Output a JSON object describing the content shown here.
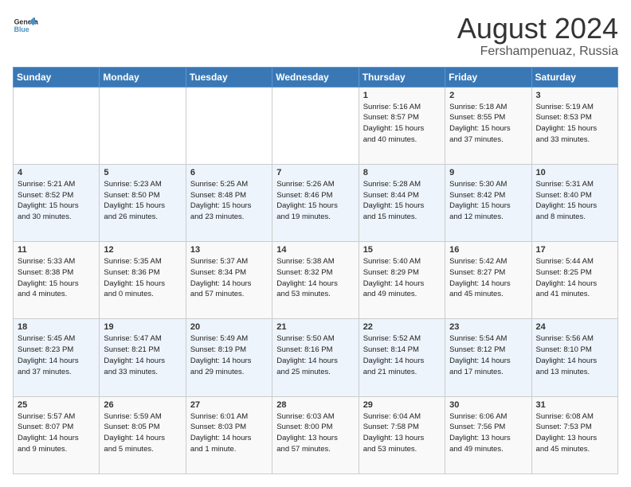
{
  "logo": {
    "line1": "General",
    "line2": "Blue"
  },
  "title": "August 2024",
  "subtitle": "Fershampenuaz, Russia",
  "days_of_week": [
    "Sunday",
    "Monday",
    "Tuesday",
    "Wednesday",
    "Thursday",
    "Friday",
    "Saturday"
  ],
  "weeks": [
    [
      {
        "day": "",
        "info": ""
      },
      {
        "day": "",
        "info": ""
      },
      {
        "day": "",
        "info": ""
      },
      {
        "day": "",
        "info": ""
      },
      {
        "day": "1",
        "info": "Sunrise: 5:16 AM\nSunset: 8:57 PM\nDaylight: 15 hours\nand 40 minutes."
      },
      {
        "day": "2",
        "info": "Sunrise: 5:18 AM\nSunset: 8:55 PM\nDaylight: 15 hours\nand 37 minutes."
      },
      {
        "day": "3",
        "info": "Sunrise: 5:19 AM\nSunset: 8:53 PM\nDaylight: 15 hours\nand 33 minutes."
      }
    ],
    [
      {
        "day": "4",
        "info": "Sunrise: 5:21 AM\nSunset: 8:52 PM\nDaylight: 15 hours\nand 30 minutes."
      },
      {
        "day": "5",
        "info": "Sunrise: 5:23 AM\nSunset: 8:50 PM\nDaylight: 15 hours\nand 26 minutes."
      },
      {
        "day": "6",
        "info": "Sunrise: 5:25 AM\nSunset: 8:48 PM\nDaylight: 15 hours\nand 23 minutes."
      },
      {
        "day": "7",
        "info": "Sunrise: 5:26 AM\nSunset: 8:46 PM\nDaylight: 15 hours\nand 19 minutes."
      },
      {
        "day": "8",
        "info": "Sunrise: 5:28 AM\nSunset: 8:44 PM\nDaylight: 15 hours\nand 15 minutes."
      },
      {
        "day": "9",
        "info": "Sunrise: 5:30 AM\nSunset: 8:42 PM\nDaylight: 15 hours\nand 12 minutes."
      },
      {
        "day": "10",
        "info": "Sunrise: 5:31 AM\nSunset: 8:40 PM\nDaylight: 15 hours\nand 8 minutes."
      }
    ],
    [
      {
        "day": "11",
        "info": "Sunrise: 5:33 AM\nSunset: 8:38 PM\nDaylight: 15 hours\nand 4 minutes."
      },
      {
        "day": "12",
        "info": "Sunrise: 5:35 AM\nSunset: 8:36 PM\nDaylight: 15 hours\nand 0 minutes."
      },
      {
        "day": "13",
        "info": "Sunrise: 5:37 AM\nSunset: 8:34 PM\nDaylight: 14 hours\nand 57 minutes."
      },
      {
        "day": "14",
        "info": "Sunrise: 5:38 AM\nSunset: 8:32 PM\nDaylight: 14 hours\nand 53 minutes."
      },
      {
        "day": "15",
        "info": "Sunrise: 5:40 AM\nSunset: 8:29 PM\nDaylight: 14 hours\nand 49 minutes."
      },
      {
        "day": "16",
        "info": "Sunrise: 5:42 AM\nSunset: 8:27 PM\nDaylight: 14 hours\nand 45 minutes."
      },
      {
        "day": "17",
        "info": "Sunrise: 5:44 AM\nSunset: 8:25 PM\nDaylight: 14 hours\nand 41 minutes."
      }
    ],
    [
      {
        "day": "18",
        "info": "Sunrise: 5:45 AM\nSunset: 8:23 PM\nDaylight: 14 hours\nand 37 minutes."
      },
      {
        "day": "19",
        "info": "Sunrise: 5:47 AM\nSunset: 8:21 PM\nDaylight: 14 hours\nand 33 minutes."
      },
      {
        "day": "20",
        "info": "Sunrise: 5:49 AM\nSunset: 8:19 PM\nDaylight: 14 hours\nand 29 minutes."
      },
      {
        "day": "21",
        "info": "Sunrise: 5:50 AM\nSunset: 8:16 PM\nDaylight: 14 hours\nand 25 minutes."
      },
      {
        "day": "22",
        "info": "Sunrise: 5:52 AM\nSunset: 8:14 PM\nDaylight: 14 hours\nand 21 minutes."
      },
      {
        "day": "23",
        "info": "Sunrise: 5:54 AM\nSunset: 8:12 PM\nDaylight: 14 hours\nand 17 minutes."
      },
      {
        "day": "24",
        "info": "Sunrise: 5:56 AM\nSunset: 8:10 PM\nDaylight: 14 hours\nand 13 minutes."
      }
    ],
    [
      {
        "day": "25",
        "info": "Sunrise: 5:57 AM\nSunset: 8:07 PM\nDaylight: 14 hours\nand 9 minutes."
      },
      {
        "day": "26",
        "info": "Sunrise: 5:59 AM\nSunset: 8:05 PM\nDaylight: 14 hours\nand 5 minutes."
      },
      {
        "day": "27",
        "info": "Sunrise: 6:01 AM\nSunset: 8:03 PM\nDaylight: 14 hours\nand 1 minute."
      },
      {
        "day": "28",
        "info": "Sunrise: 6:03 AM\nSunset: 8:00 PM\nDaylight: 13 hours\nand 57 minutes."
      },
      {
        "day": "29",
        "info": "Sunrise: 6:04 AM\nSunset: 7:58 PM\nDaylight: 13 hours\nand 53 minutes."
      },
      {
        "day": "30",
        "info": "Sunrise: 6:06 AM\nSunset: 7:56 PM\nDaylight: 13 hours\nand 49 minutes."
      },
      {
        "day": "31",
        "info": "Sunrise: 6:08 AM\nSunset: 7:53 PM\nDaylight: 13 hours\nand 45 minutes."
      }
    ]
  ]
}
